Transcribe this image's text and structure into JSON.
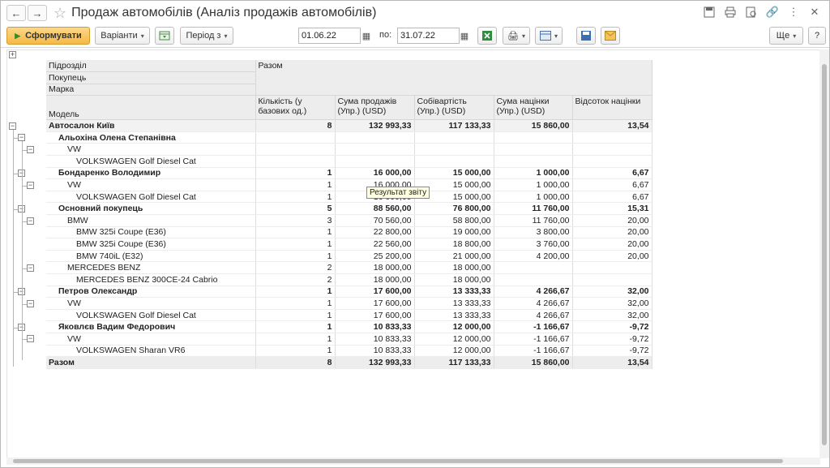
{
  "window": {
    "title": "Продаж автомобілів (Аналіз продажів автомобілів)"
  },
  "toolbar": {
    "generate_label": "Сформувати",
    "variants_label": "Варіанти",
    "period_label": "Період з",
    "date_from": "01.06.22",
    "to_label": "по:",
    "date_to": "31.07.22",
    "more_label": "Ще",
    "help_label": "?"
  },
  "tooltip": "Результат звіту",
  "report": {
    "dimension_headers": [
      "Підрозділ",
      "Покупець",
      "Марка",
      "Модель"
    ],
    "total_header": "Разом",
    "columns": [
      "Кількість (у базових од.)",
      "Сума продажів (Упр.) (USD)",
      "Собівартість (Упр.) (USD)",
      "Сума націнки (Упр.) (USD)",
      "Відсоток націнки"
    ],
    "rows": [
      {
        "level": 0,
        "bold": true,
        "label": "Автосалон Київ",
        "qty": "8",
        "sales": "132 993,33",
        "cost": "117 133,33",
        "markup": "15 860,00",
        "pct": "13,54"
      },
      {
        "level": 1,
        "bold": true,
        "label": "Альохіна Олена Степанівна",
        "qty": "",
        "sales": "",
        "cost": "",
        "markup": "",
        "pct": ""
      },
      {
        "level": 2,
        "bold": false,
        "label": "VW",
        "qty": "",
        "sales": "",
        "cost": "",
        "markup": "",
        "pct": ""
      },
      {
        "level": 3,
        "bold": false,
        "label": "VOLKSWAGEN Golf Diesel Cat",
        "qty": "",
        "sales": "",
        "cost": "",
        "markup": "",
        "pct": ""
      },
      {
        "level": 1,
        "bold": true,
        "label": "Бондаренко Володимир",
        "qty": "1",
        "sales": "16 000,00",
        "cost": "15 000,00",
        "markup": "1 000,00",
        "pct": "6,67"
      },
      {
        "level": 2,
        "bold": false,
        "label": "VW",
        "qty": "1",
        "sales": "16 000,00",
        "cost": "15 000,00",
        "markup": "1 000,00",
        "pct": "6,67"
      },
      {
        "level": 3,
        "bold": false,
        "label": "VOLKSWAGEN Golf Diesel Cat",
        "qty": "1",
        "sales": "16 000,00",
        "cost": "15 000,00",
        "markup": "1 000,00",
        "pct": "6,67"
      },
      {
        "level": 1,
        "bold": true,
        "label": "Основний покупець",
        "qty": "5",
        "sales": "88 560,00",
        "cost": "76 800,00",
        "markup": "11 760,00",
        "pct": "15,31"
      },
      {
        "level": 2,
        "bold": false,
        "label": "BMW",
        "qty": "3",
        "sales": "70 560,00",
        "cost": "58 800,00",
        "markup": "11 760,00",
        "pct": "20,00"
      },
      {
        "level": 3,
        "bold": false,
        "label": "BMW 325i Coupe (E36)",
        "qty": "1",
        "sales": "22 800,00",
        "cost": "19 000,00",
        "markup": "3 800,00",
        "pct": "20,00"
      },
      {
        "level": 3,
        "bold": false,
        "label": "BMW 325i Coupe (E36)",
        "qty": "1",
        "sales": "22 560,00",
        "cost": "18 800,00",
        "markup": "3 760,00",
        "pct": "20,00"
      },
      {
        "level": 3,
        "bold": false,
        "label": "BMW 740iL (E32)",
        "qty": "1",
        "sales": "25 200,00",
        "cost": "21 000,00",
        "markup": "4 200,00",
        "pct": "20,00"
      },
      {
        "level": 2,
        "bold": false,
        "label": "MERCEDES BENZ",
        "qty": "2",
        "sales": "18 000,00",
        "cost": "18 000,00",
        "markup": "",
        "pct": ""
      },
      {
        "level": 3,
        "bold": false,
        "label": "MERCEDES BENZ 300CE-24 Cabrio",
        "qty": "2",
        "sales": "18 000,00",
        "cost": "18 000,00",
        "markup": "",
        "pct": ""
      },
      {
        "level": 1,
        "bold": true,
        "label": "Петров Олександр",
        "qty": "1",
        "sales": "17 600,00",
        "cost": "13 333,33",
        "markup": "4 266,67",
        "pct": "32,00"
      },
      {
        "level": 2,
        "bold": false,
        "label": "VW",
        "qty": "1",
        "sales": "17 600,00",
        "cost": "13 333,33",
        "markup": "4 266,67",
        "pct": "32,00"
      },
      {
        "level": 3,
        "bold": false,
        "label": "VOLKSWAGEN Golf Diesel Cat",
        "qty": "1",
        "sales": "17 600,00",
        "cost": "13 333,33",
        "markup": "4 266,67",
        "pct": "32,00"
      },
      {
        "level": 1,
        "bold": true,
        "label": "Яковлєв Вадим Федорович",
        "qty": "1",
        "sales": "10 833,33",
        "cost": "12 000,00",
        "markup": "-1 166,67",
        "pct": "-9,72"
      },
      {
        "level": 2,
        "bold": false,
        "label": "VW",
        "qty": "1",
        "sales": "10 833,33",
        "cost": "12 000,00",
        "markup": "-1 166,67",
        "pct": "-9,72"
      },
      {
        "level": 3,
        "bold": false,
        "label": "VOLKSWAGEN Sharan VR6",
        "qty": "1",
        "sales": "10 833,33",
        "cost": "12 000,00",
        "markup": "-1 166,67",
        "pct": "-9,72"
      }
    ],
    "grand_total": {
      "label": "Разом",
      "qty": "8",
      "sales": "132 993,33",
      "cost": "117 133,33",
      "markup": "15 860,00",
      "pct": "13,54"
    }
  }
}
